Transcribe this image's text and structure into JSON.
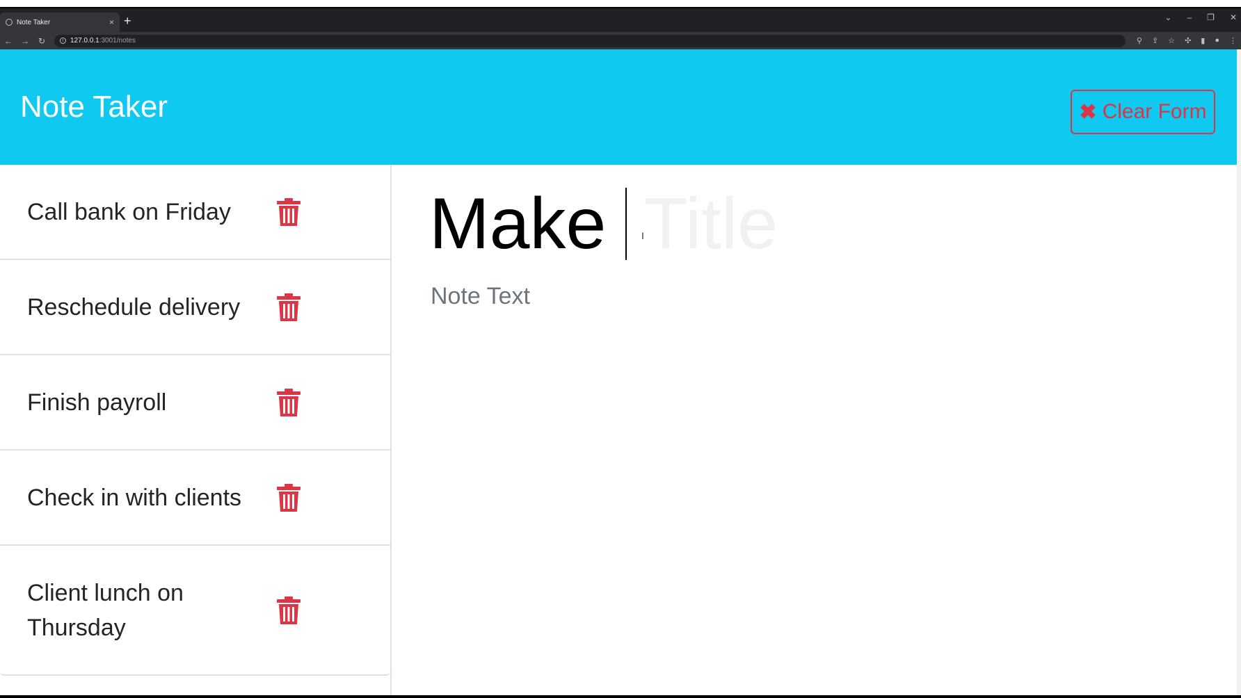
{
  "browser": {
    "tab_title": "Note Taker",
    "tab_close": "×",
    "new_tab": "+",
    "url_host": "127.0.0.1",
    "url_path": ":3001/notes",
    "window_controls": [
      "⌄",
      "–",
      "❐",
      "✕"
    ]
  },
  "navbar": {
    "brand": "Note Taker",
    "clear_label": "Clear Form",
    "clear_icon": "✖"
  },
  "notes": [
    {
      "title": "Call bank on Friday"
    },
    {
      "title": "Reschedule delivery"
    },
    {
      "title": "Finish payroll"
    },
    {
      "title": "Check in with clients"
    },
    {
      "title": "Client lunch on Thursday"
    }
  ],
  "editor": {
    "title_value": "Make",
    "title_placeholder": "Title",
    "text_placeholder": "Note Text"
  },
  "colors": {
    "navbar": "#10c9f1",
    "danger": "#dc3545"
  }
}
